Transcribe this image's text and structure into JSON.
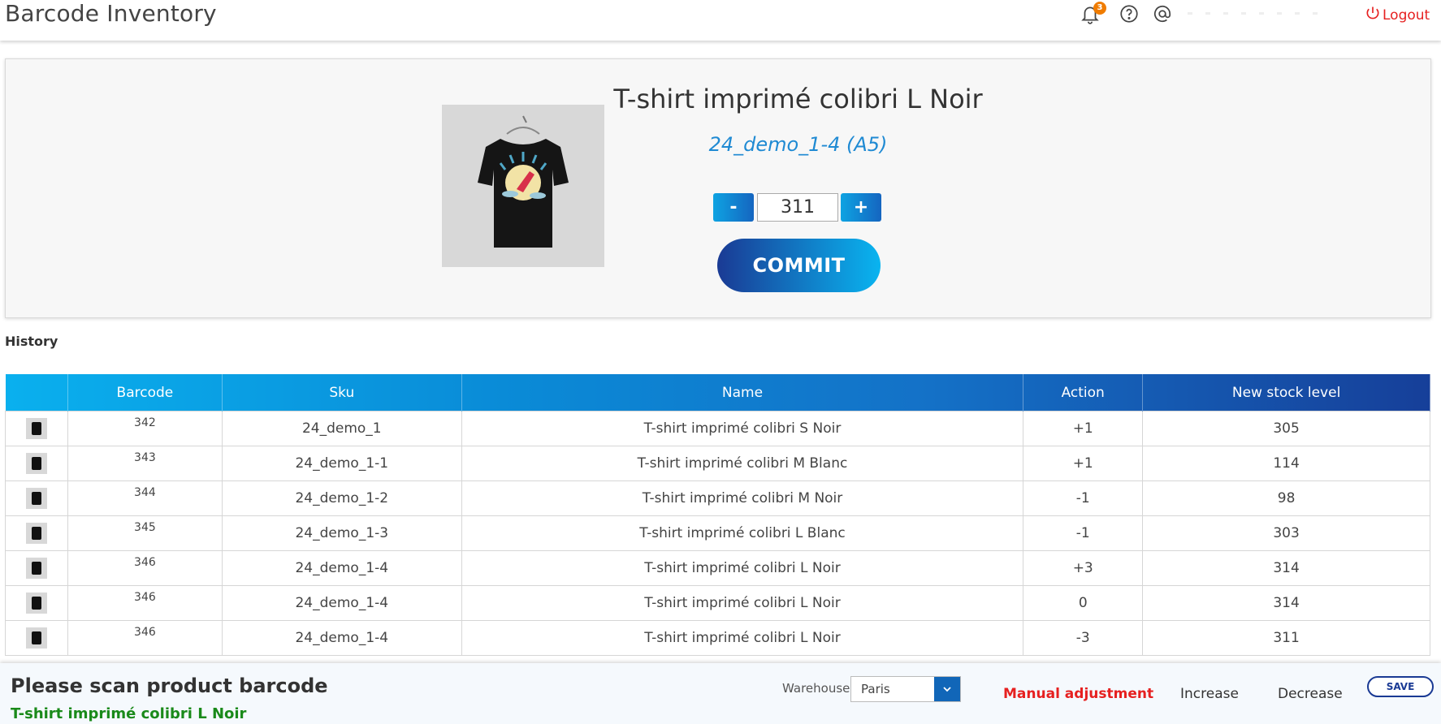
{
  "header": {
    "title": "Barcode Inventory",
    "notification_count": "3",
    "logout_label": "Logout"
  },
  "product": {
    "title": "T-shirt imprimé colibri L Noir",
    "sku_location": "24_demo_1-4 (A5)",
    "quantity": "311",
    "minus_label": "-",
    "plus_label": "+",
    "commit_label": "COMMIT"
  },
  "history": {
    "label": "History",
    "columns": [
      "",
      "Barcode",
      "Sku",
      "Name",
      "Action",
      "New stock level"
    ],
    "rows": [
      {
        "barcode": "342",
        "sku": "24_demo_1",
        "name": "T-shirt imprimé colibri S Noir",
        "action": "+1",
        "level": "305"
      },
      {
        "barcode": "343",
        "sku": "24_demo_1-1",
        "name": "T-shirt imprimé colibri M Blanc",
        "action": "+1",
        "level": "114"
      },
      {
        "barcode": "344",
        "sku": "24_demo_1-2",
        "name": "T-shirt imprimé colibri M Noir",
        "action": "-1",
        "level": "98"
      },
      {
        "barcode": "345",
        "sku": "24_demo_1-3",
        "name": "T-shirt imprimé colibri L Blanc",
        "action": "-1",
        "level": "303"
      },
      {
        "barcode": "346",
        "sku": "24_demo_1-4",
        "name": "T-shirt imprimé colibri L Noir",
        "action": "+3",
        "level": "314"
      },
      {
        "barcode": "346",
        "sku": "24_demo_1-4",
        "name": "T-shirt imprimé colibri L Noir",
        "action": "0",
        "level": "314"
      },
      {
        "barcode": "346",
        "sku": "24_demo_1-4",
        "name": "T-shirt imprimé colibri L Noir",
        "action": "-3",
        "level": "311"
      }
    ]
  },
  "footer": {
    "scan_prompt": "Please scan product barcode",
    "scan_result": "T-shirt imprimé colibri L Noir",
    "warehouse_label": "Warehouse",
    "warehouse_value": "Paris",
    "mode_manual": "Manual adjustment",
    "mode_increase": "Increase",
    "mode_decrease": "Decrease",
    "save_label": "SAVE"
  },
  "colors": {
    "accent_blue": "#1565c0",
    "danger_red": "#e62020",
    "success_green": "#1a8a1a",
    "notification_orange": "#f07c00"
  },
  "icons": {
    "notification": "bell-icon",
    "help": "question-circle-icon",
    "account": "at-sign-icon",
    "logout": "power-icon",
    "dropdown": "chevron-down-icon"
  }
}
